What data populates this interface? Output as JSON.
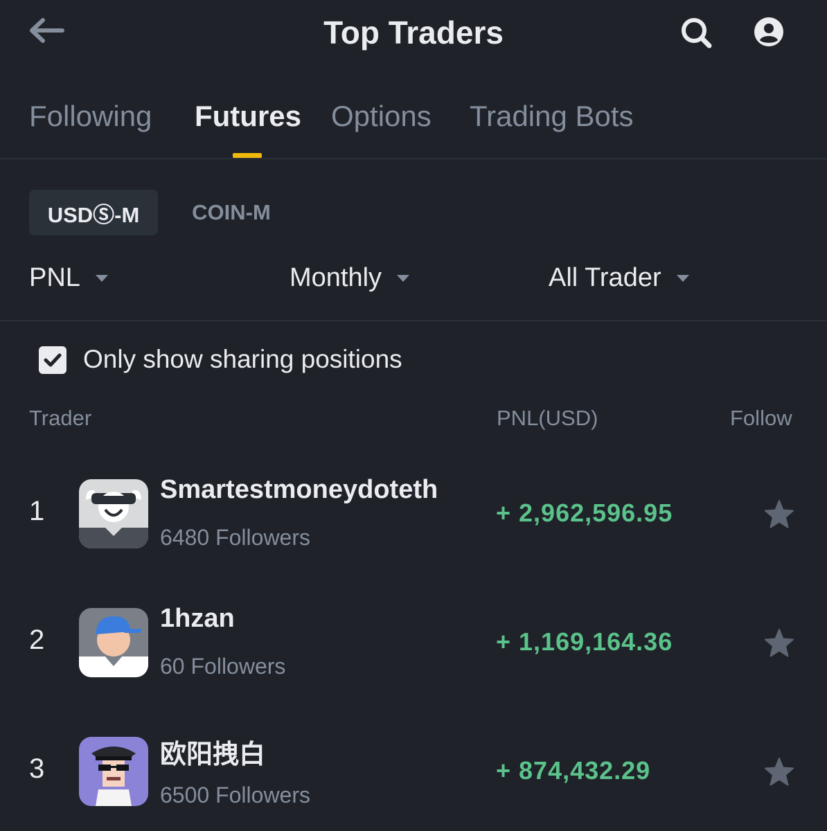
{
  "header": {
    "title": "Top Traders"
  },
  "tabs": [
    {
      "label": "Following"
    },
    {
      "label": "Futures"
    },
    {
      "label": "Options"
    },
    {
      "label": "Trading Bots"
    }
  ],
  "segments": {
    "active": "USDⓈ-M",
    "inactive": "COIN-M"
  },
  "filters": {
    "metric": "PNL",
    "period": "Monthly",
    "trader_type": "All Trader"
  },
  "sharing_toggle": {
    "label": "Only show sharing positions",
    "checked": true
  },
  "columns": {
    "trader": "Trader",
    "pnl": "PNL(USD)",
    "follow": "Follow"
  },
  "traders": [
    {
      "rank": "1",
      "name": "Smartestmoneydoteth",
      "followers": "6480 Followers",
      "pnl": "+ 2,962,596.95"
    },
    {
      "rank": "2",
      "name": "1hzan",
      "followers": "60 Followers",
      "pnl": "+ 1,169,164.36"
    },
    {
      "rank": "3",
      "name": "欧阳拽白",
      "followers": "6500 Followers",
      "pnl": "+ 874,432.29"
    }
  ],
  "colors": {
    "accent": "#f0b90b",
    "positive": "#5bc28b",
    "background": "#1f2229",
    "muted": "#848e9c"
  },
  "icons": [
    "back-arrow-icon",
    "search-icon",
    "account-icon",
    "checkbox-check-icon",
    "star-icon"
  ]
}
